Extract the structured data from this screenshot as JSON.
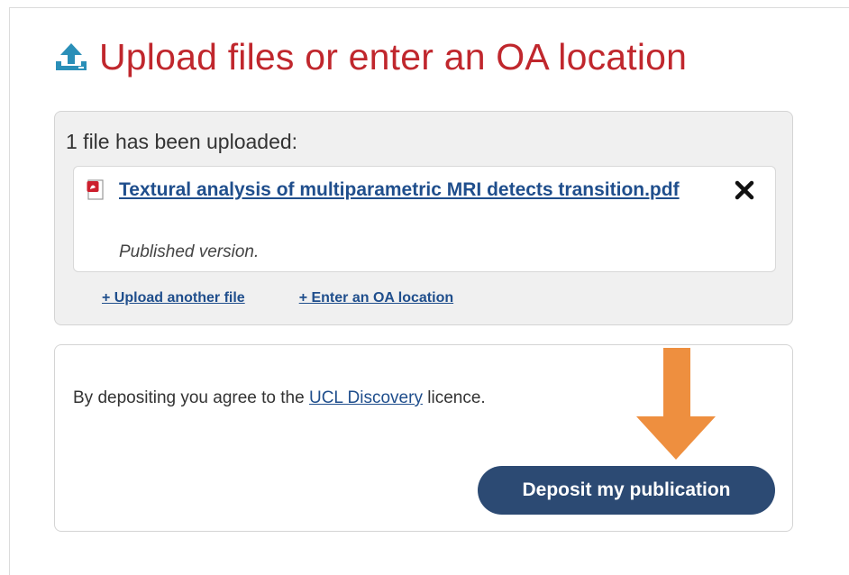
{
  "heading": {
    "title": "Upload files or enter an OA location",
    "icon": "upload-icon",
    "color": "#c0272d"
  },
  "upload_panel": {
    "status_text": "1 file has been uploaded:",
    "files": [
      {
        "name": "Textural analysis of multiparametric MRI detects transition.pdf",
        "version": "Published version.",
        "icon": "pdf-icon",
        "remove_icon": "close-icon"
      }
    ],
    "upload_another_label": "+ Upload another file",
    "enter_oa_label": "+ Enter an OA location"
  },
  "deposit_panel": {
    "licence_prefix": "By depositing you agree to the ",
    "licence_link": "UCL Discovery",
    "licence_suffix": " licence.",
    "deposit_button_label": "Deposit my publication",
    "annotation_arrow_color": "#ee8f3f",
    "button_color": "#2c4a73"
  }
}
